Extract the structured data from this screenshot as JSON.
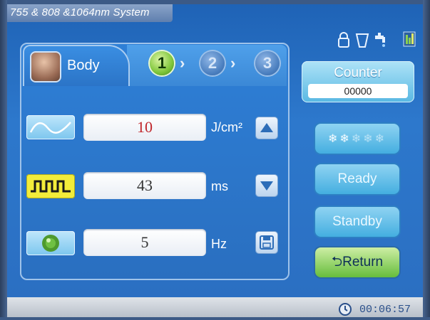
{
  "window": {
    "title": "755 & 808 &1064nm System"
  },
  "status_icons": [
    "lock-icon",
    "handpiece-icon",
    "water-tap-icon",
    "water-level-icon"
  ],
  "mode_tab": {
    "label": "Body",
    "icon": "body-avatar"
  },
  "steps": [
    {
      "number": "1",
      "active": true
    },
    {
      "number": "2",
      "active": false
    },
    {
      "number": "3",
      "active": false
    }
  ],
  "params": {
    "fluence": {
      "value": "10",
      "unit": "J/cm²",
      "icon": "waveform-icon",
      "value_color": "#c0262b"
    },
    "pulse_width": {
      "value": "43",
      "unit": "ms",
      "icon": "pulse-train-icon",
      "value_color": "#333333"
    },
    "frequency": {
      "value": "5",
      "unit": "Hz",
      "icon": "frequency-icon",
      "value_color": "#333333"
    }
  },
  "controls": {
    "up_icon": "arrow-up-icon",
    "down_icon": "arrow-down-icon",
    "save_icon": "save-icon"
  },
  "counter": {
    "label": "Counter",
    "value": "00000"
  },
  "cooling": {
    "icon": "snowflake-icon",
    "levels": 5,
    "active_levels": 2
  },
  "buttons": {
    "ready": "Ready",
    "standby": "Standby",
    "return": "Return"
  },
  "status_bar": {
    "time": "00:06:57"
  }
}
